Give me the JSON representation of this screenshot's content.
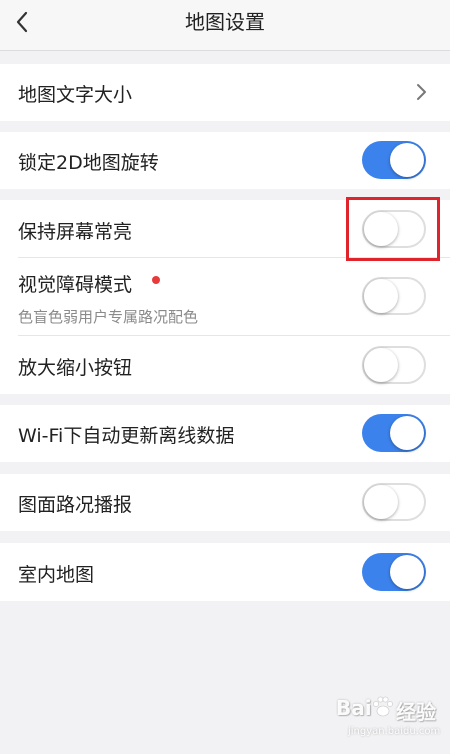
{
  "header": {
    "title": "地图设置",
    "back_icon": "chevron-left-icon"
  },
  "settings": {
    "font_size": {
      "label": "地图文字大小",
      "icon": "chevron-right-icon"
    },
    "lock_2d_rotation": {
      "label": "锁定2D地图旋转",
      "enabled": true
    },
    "keep_screen_on": {
      "label": "保持屏幕常亮",
      "enabled": false
    },
    "visual_impairment_mode": {
      "label": "视觉障碍模式",
      "description": "色盲色弱用户专属路况配色",
      "enabled": false,
      "badge_color": "#e83a3a"
    },
    "zoom_buttons": {
      "label": "放大缩小按钮",
      "enabled": false
    },
    "wifi_auto_update": {
      "label": "Wi-Fi下自动更新离线数据",
      "enabled": true
    },
    "road_condition_broadcast": {
      "label": "图面路况播报",
      "enabled": false
    },
    "indoor_map": {
      "label": "室内地图",
      "enabled": true
    }
  },
  "watermark": {
    "text": "Bai",
    "text_cn": "经验",
    "sub": "jingyan.baidu.com",
    "icon": "paw-icon"
  },
  "colors": {
    "toggle_on": "#3c82ec",
    "highlight": "#e0242b",
    "background": "#f2f2f4"
  }
}
